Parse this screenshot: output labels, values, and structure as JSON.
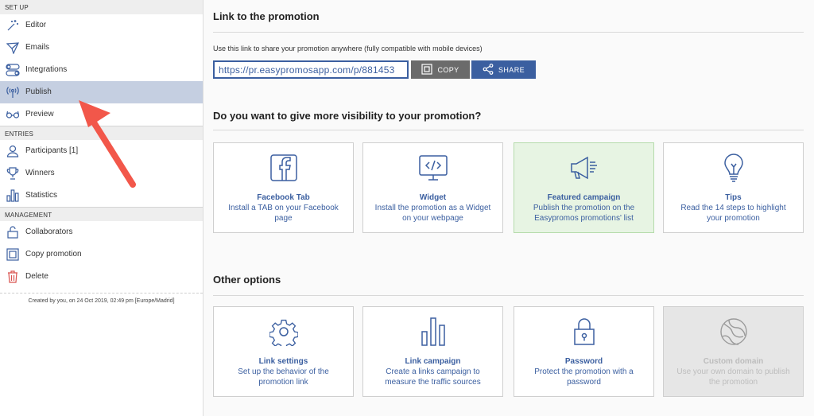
{
  "sidebar": {
    "sections": {
      "setup": "SET UP",
      "entries": "ENTRIES",
      "management": "MANAGEMENT"
    },
    "setup_items": [
      {
        "label": "Editor",
        "icon": "magic-wand-icon"
      },
      {
        "label": "Emails",
        "icon": "paper-plane-icon"
      },
      {
        "label": "Integrations",
        "icon": "toggles-icon"
      },
      {
        "label": "Publish",
        "icon": "broadcast-icon",
        "active": true
      },
      {
        "label": "Preview",
        "icon": "glasses-icon"
      }
    ],
    "entries_items": [
      {
        "label": "Participants [1]",
        "icon": "user-icon"
      },
      {
        "label": "Winners",
        "icon": "trophy-icon"
      },
      {
        "label": "Statistics",
        "icon": "bar-chart-icon"
      }
    ],
    "management_items": [
      {
        "label": "Collaborators",
        "icon": "lock-icon"
      },
      {
        "label": "Copy promotion",
        "icon": "copy-icon"
      },
      {
        "label": "Delete",
        "icon": "trash-icon"
      }
    ],
    "created": "Created by you, on 24 Oct 2019, 02:49 pm [Europe/Madrid]"
  },
  "link_section": {
    "title": "Link to the promotion",
    "description": "Use this link to share your promotion anywhere (fully compatible with mobile devices)",
    "url": "https://pr.easypromosapp.com/p/881453",
    "copy_label": "COPY",
    "share_label": "SHARE"
  },
  "visibility_section": {
    "title": "Do you want to give more visibility to your promotion?",
    "cards": [
      {
        "title": "Facebook Tab",
        "desc": "Install a TAB on your Facebook page",
        "icon": "facebook-icon"
      },
      {
        "title": "Widget",
        "desc": "Install the promotion as a Widget on your webpage",
        "icon": "code-window-icon"
      },
      {
        "title": "Featured campaign",
        "desc": "Publish the promotion on the Easypromos promotions' list",
        "icon": "megaphone-icon"
      },
      {
        "title": "Tips",
        "desc": "Read the 14 steps to highlight your promotion",
        "icon": "lightbulb-icon"
      }
    ]
  },
  "other_section": {
    "title": "Other options",
    "cards": [
      {
        "title": "Link settings",
        "desc": "Set up the behavior of the promotion link",
        "icon": "gear-icon"
      },
      {
        "title": "Link campaign",
        "desc": "Create a links campaign to measure the traffic sources",
        "icon": "bar-chart-icon"
      },
      {
        "title": "Password",
        "desc": "Protect the promotion with a password",
        "icon": "padlock-icon"
      },
      {
        "title": "Custom domain",
        "desc": "Use your own domain to publish the promotion",
        "icon": "globe-icon"
      }
    ]
  },
  "colors": {
    "accent": "#3b5fa0",
    "active_nav": "#c5cfe1",
    "featured_bg": "#e7f4e3",
    "arrow": "#f2574a"
  }
}
